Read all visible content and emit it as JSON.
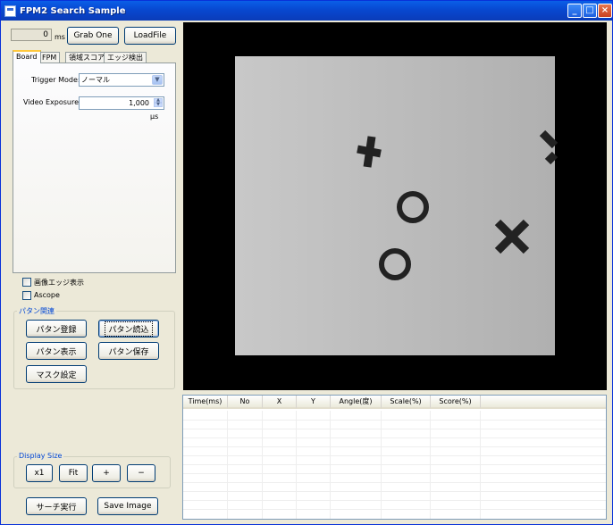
{
  "window": {
    "title": "FPM2 Search Sample"
  },
  "controls": {
    "minimize": "_",
    "maximize": "□",
    "close": "×"
  },
  "toolbar": {
    "time_value": "0",
    "time_unit": "ms",
    "grab_one": "Grab One",
    "load_file": "LoadFile"
  },
  "tabs": [
    "Board",
    "FPM",
    "領域スコア",
    "エッジ検出"
  ],
  "board": {
    "trigger_label": "Trigger Mode:",
    "trigger_value": "ノーマル",
    "exposure_label": "Video Exposure:",
    "exposure_value": "1,000",
    "exposure_unit": "μs"
  },
  "checkboxes": [
    {
      "label": "画像エッジ表示",
      "checked": false
    },
    {
      "label": "Ascope",
      "checked": false
    }
  ],
  "pattern_group": {
    "title": "パタン関連",
    "register": "パタン登録",
    "load": "パタン読込",
    "display": "パタン表示",
    "save": "パタン保存",
    "mask": "マスク設定"
  },
  "display_size": {
    "title": "Display Size",
    "x1": "x1",
    "fit": "Fit",
    "plus": "+",
    "minus": "−"
  },
  "bottom": {
    "search": "サーチ実行",
    "save_image": "Save Image"
  },
  "results_table": {
    "columns": [
      "Time(ms)",
      "No",
      "X",
      "Y",
      "Angle(度)",
      "Scale(%)",
      "Score(%)"
    ],
    "rows": []
  },
  "colors": {
    "title_bar": "#0848d0",
    "accent": "#0046d5",
    "image_bg": "#000000"
  },
  "icons": {
    "dropdown": "chevron-down-icon",
    "spin_up": "spin-up-icon",
    "spin_down": "spin-down-icon"
  }
}
